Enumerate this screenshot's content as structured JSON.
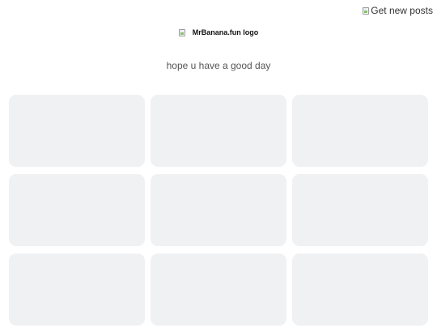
{
  "header": {
    "get_new_posts_label": "Get new posts",
    "get_new_posts_icon": "broken-image-icon"
  },
  "logo": {
    "alt_text": "MrBanana.fun logo",
    "icon": "broken-image-icon"
  },
  "tagline": "hope u have a good day",
  "posts": {
    "placeholder_count": 9,
    "placeholder_color": "#f0f1f3"
  }
}
